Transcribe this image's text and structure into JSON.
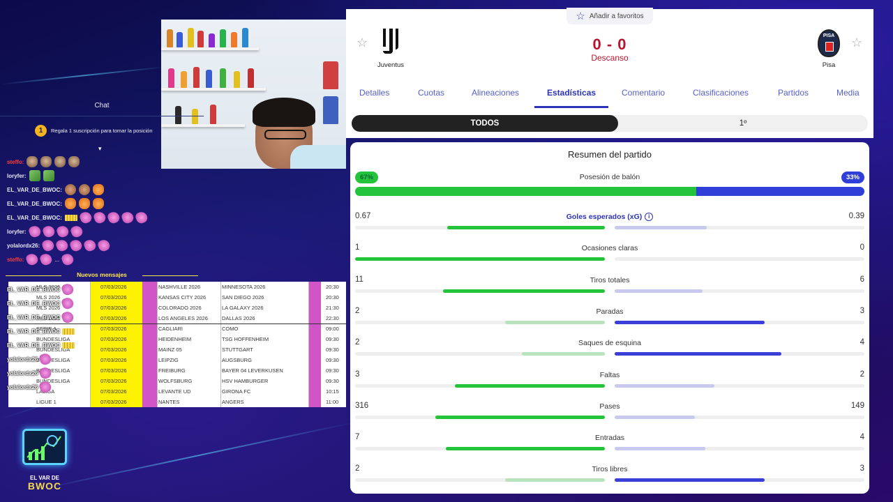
{
  "chat": {
    "title": "Chat",
    "pinned": {
      "badge": "1",
      "text": "Regala 1 suscripción para tomar la posición"
    },
    "lines": [
      {
        "user": "steffo:",
        "color": "#ff3b3b",
        "emotes": [
          "cat",
          "cat",
          "cat",
          "cat"
        ]
      },
      {
        "user": "loryfer:",
        "color": "#e8e8f5",
        "emotes": [
          "money",
          "money"
        ]
      },
      {
        "user": "EL_VAR_DE_BWOC:",
        "color": "#e8e8f5",
        "emotes": [
          "face",
          "face",
          "orange"
        ]
      },
      {
        "user": "EL_VAR_DE_BWOC:",
        "color": "#e8e8f5",
        "emotes": [
          "orange",
          "orange",
          "orange"
        ]
      },
      {
        "user": "EL_VAR_DE_BWOC:",
        "color": "#e8e8f5",
        "emotes": [
          "gold",
          "pink",
          "pink",
          "pink",
          "pink",
          "pink"
        ]
      },
      {
        "user": "loryfer:",
        "color": "#e8e8f5",
        "emotes": [
          "pink",
          "pink",
          "pink",
          "pink"
        ]
      },
      {
        "user": "yolalordx26:",
        "color": "#e8e8f5",
        "emotes": [
          "pink",
          "pink",
          "pink",
          "pink",
          "pink"
        ]
      },
      {
        "user": "steffo:",
        "color": "#ff3b3b",
        "emotes": [
          "pink",
          "pink",
          "dots",
          "pink"
        ]
      }
    ],
    "new_messages": "Nuevos mensajes",
    "dots": "..."
  },
  "overlay_users": [
    {
      "user": "EL_VAR_DE_BWOC",
      "emote": "pink"
    },
    {
      "user": "EL_VAR_DE_BWOC",
      "emote": "pink"
    },
    {
      "user": "EL_VAR_DE_BWOC",
      "emote": "pink"
    },
    {
      "user": "EL_VAR_DE_BWOC",
      "emote": "gold"
    },
    {
      "user": "EL_VAR_DE_BWOC",
      "emote": "gold"
    },
    {
      "user": "yolalordx26",
      "emote": "pink"
    },
    {
      "user": "yolalordx26",
      "emote": "pink"
    },
    {
      "user": "yolalordx26",
      "emote": "pink"
    }
  ],
  "schedule": [
    {
      "league": "MLS 2026",
      "date": "07/03/2026",
      "home": "NASHVILLE 2026",
      "away": "MINNESOTA 2026",
      "time": "20:30"
    },
    {
      "league": "MLS 2026",
      "date": "07/03/2026",
      "home": "KANSAS CITY 2026",
      "away": "SAN DIEGO 2026",
      "time": "20:30"
    },
    {
      "league": "MLS 2026",
      "date": "07/03/2026",
      "home": "COLORADO 2026",
      "away": "LA GALAXY 2026",
      "time": "21:30"
    },
    {
      "league": "MLS 2026",
      "date": "07/03/2026",
      "home": "LOS ANGELES 2026",
      "away": "DALLAS 2026",
      "time": "22:30"
    },
    {
      "league": "SERIE A",
      "date": "07/03/2026",
      "home": "CAGLIARI",
      "away": "COMO",
      "time": "09:00"
    },
    {
      "league": "BUNDESLIGA",
      "date": "07/03/2026",
      "home": "HEIDENHEIM",
      "away": "TSG HOFFENHEIM",
      "time": "09:30"
    },
    {
      "league": "BUNDESLIGA",
      "date": "07/03/2026",
      "home": "MAINZ 05",
      "away": "STUTTGART",
      "time": "09:30"
    },
    {
      "league": "BUNDESLIGA",
      "date": "07/03/2026",
      "home": "LEIPZIG",
      "away": "AUGSBURG",
      "time": "09:30"
    },
    {
      "league": "BUNDESLIGA",
      "date": "07/03/2026",
      "home": "FREIBURG",
      "away": "BAYER 04 LEVERKUSEN",
      "time": "09:30"
    },
    {
      "league": "BUNDESLIGA",
      "date": "07/03/2026",
      "home": "WOLFSBURG",
      "away": "HSV HAMBURGER",
      "time": "09:30"
    },
    {
      "league": "LALIGA",
      "date": "07/03/2026",
      "home": "LEVANTE UD",
      "away": "GIRONA FC",
      "time": "10:15"
    },
    {
      "league": "LIGUE 1",
      "date": "07/03/2026",
      "home": "NANTES",
      "away": "ANGERS",
      "time": "11:00"
    }
  ],
  "logo": {
    "line1": "EL VAR DE",
    "line2": "BWOC"
  },
  "match": {
    "favorite_label": "Añadir a favoritos",
    "home_team": "Juventus",
    "away_team": "Pisa",
    "away_badge": "PISA",
    "score": "0 - 0",
    "status": "Descanso",
    "tabs": [
      "Detalles",
      "Cuotas",
      "Alineaciones",
      "Estadísticas",
      "Comentario",
      "Clasificaciones",
      "Partidos",
      "Media"
    ],
    "active_tab": "Estadísticas",
    "periods": {
      "all": "TODOS",
      "first": "1º"
    }
  },
  "stats": {
    "title": "Resumen del partido",
    "possession": {
      "label": "Posesión de balón",
      "home": "67%",
      "away": "33%",
      "home_pct": 67
    },
    "rows": [
      {
        "label": "Goles esperados (xG)",
        "home": "0.67",
        "away": "0.39",
        "h": 0.67,
        "a": 0.39,
        "link": true
      },
      {
        "label": "Ocasiones claras",
        "home": "1",
        "away": "0",
        "h": 1,
        "a": 0
      },
      {
        "label": "Tiros totales",
        "home": "11",
        "away": "6",
        "h": 11,
        "a": 6
      },
      {
        "label": "Paradas",
        "home": "2",
        "away": "3",
        "h": 2,
        "a": 3
      },
      {
        "label": "Saques de esquina",
        "home": "2",
        "away": "4",
        "h": 2,
        "a": 4
      },
      {
        "label": "Faltas",
        "home": "3",
        "away": "2",
        "h": 3,
        "a": 2
      },
      {
        "label": "Pases",
        "home": "316",
        "away": "149",
        "h": 316,
        "a": 149
      },
      {
        "label": "Entradas",
        "home": "7",
        "away": "4",
        "h": 7,
        "a": 4
      },
      {
        "label": "Tiros libres",
        "home": "2",
        "away": "3",
        "h": 2,
        "a": 3
      }
    ]
  },
  "colors": {
    "home": "#23c43b",
    "away": "#2f3fd8",
    "score": "#b8142f",
    "accent": "#2b33b8"
  }
}
